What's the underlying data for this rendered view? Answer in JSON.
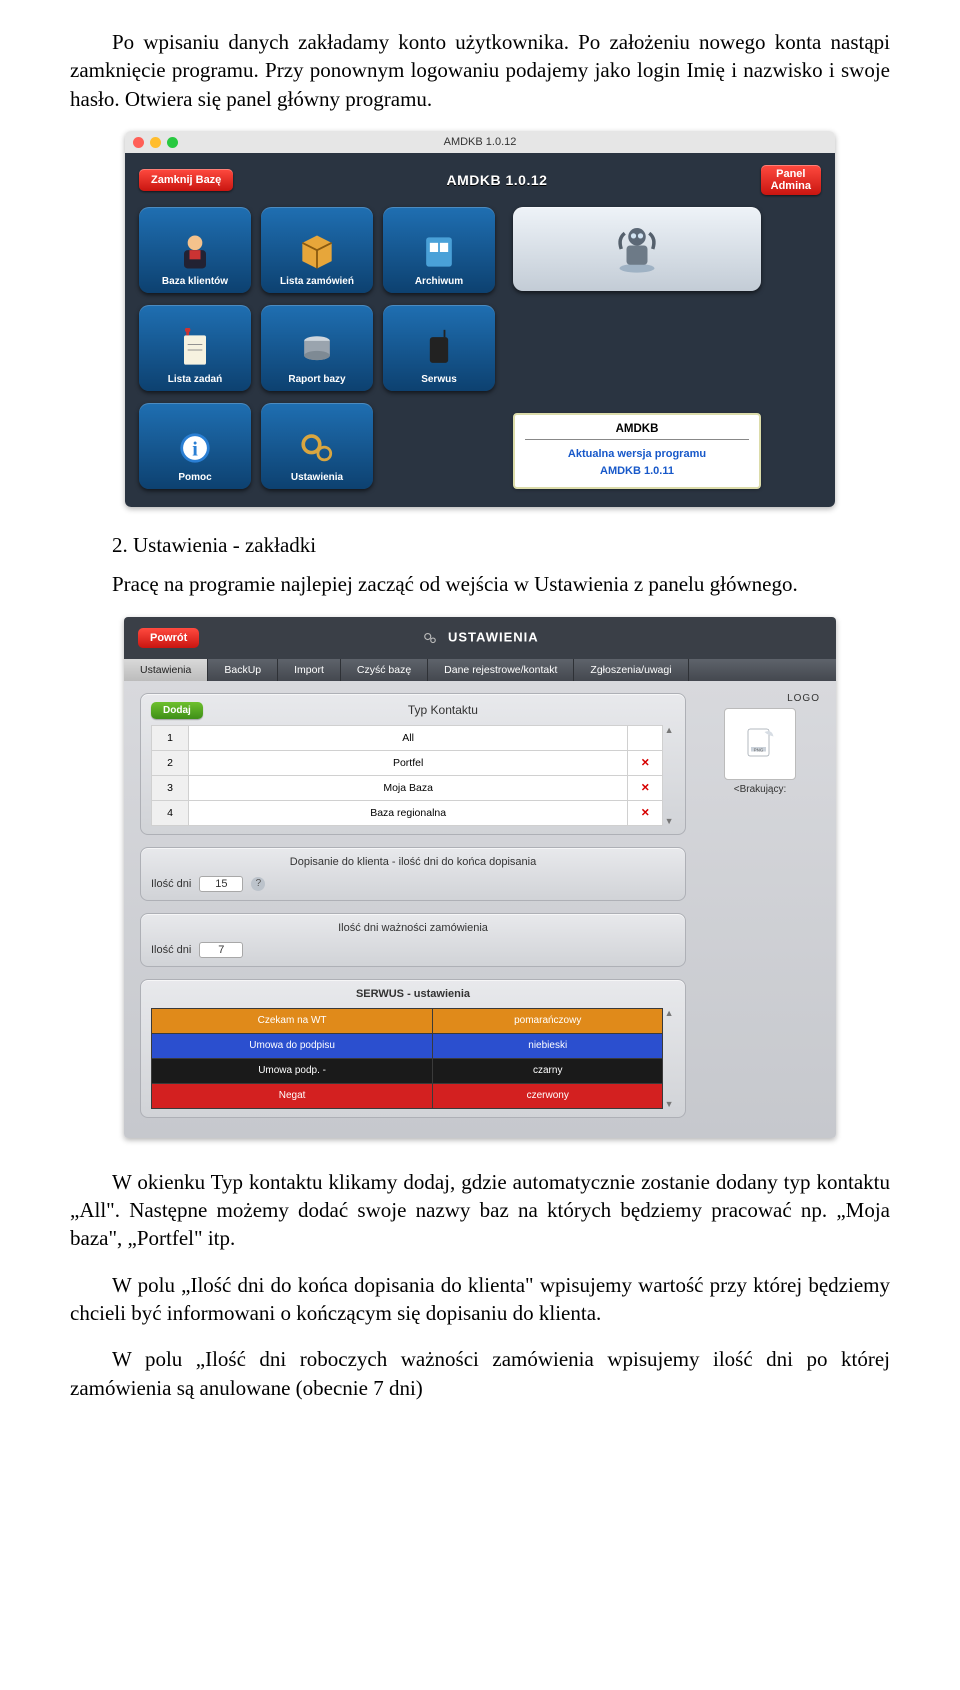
{
  "para1": "Po wpisaniu danych zakładamy konto użytkownika. Po założeniu nowego konta nastąpi zamknięcie programu. Przy ponownym logowaniu podajemy jako login Imię i nazwisko i swoje hasło. Otwiera się panel główny programu.",
  "heading2": "2. Ustawienia - zakładki",
  "para2": "Pracę na programie najlepiej zacząć od wejścia w Ustawienia z panelu głównego.",
  "para3": "W okienku Typ kontaktu klikamy dodaj, gdzie automatycznie zostanie dodany typ kontaktu „All\". Następne możemy dodać swoje nazwy baz na których będziemy pracować np. „Moja baza\", „Portfel\" itp.",
  "para4": "W polu „Ilość dni do końca dopisania do klienta\" wpisujemy wartość przy której będziemy chcieli być informowani o kończącym się dopisaniu do klienta.",
  "para5": "W polu „Ilość dni roboczych ważności zamówienia wpisujemy ilość dni po której zamówienia są anulowane (obecnie 7 dni)",
  "app": {
    "window_title": "AMDKB 1.0.12",
    "close_btn": "Zamknij Bazę",
    "brand": "AMDKB 1.0.12",
    "admin_btn_line1": "Panel",
    "admin_btn_line2": "Admina",
    "tiles": [
      {
        "label": "Baza klientów"
      },
      {
        "label": "Lista zamówień"
      },
      {
        "label": "Archiwum"
      },
      {
        "label": "Lista zadań"
      },
      {
        "label": "Raport bazy"
      },
      {
        "label": "Serwus"
      },
      {
        "label": "Pomoc"
      },
      {
        "label": "Ustawienia"
      }
    ],
    "version_card_heading": "AMDKB",
    "version_line1": "Aktualna wersja programu",
    "version_line2": "AMDKB 1.0.11"
  },
  "settings": {
    "back_btn": "Powrót",
    "title": "USTAWIENIA",
    "tabs": [
      "Ustawienia",
      "BackUp",
      "Import",
      "Czyść bazę",
      "Dane rejestrowe/kontakt",
      "Zgłoszenia/uwagi"
    ],
    "logo_label": "LOGO",
    "logo_caption": "<Brakujący:",
    "panel_typ": {
      "add_btn": "Dodaj",
      "title": "Typ Kontaktu",
      "rows": [
        {
          "n": "1",
          "name": "All",
          "del": ""
        },
        {
          "n": "2",
          "name": "Portfel",
          "del": "✕"
        },
        {
          "n": "3",
          "name": "Moja Baza",
          "del": "✕"
        },
        {
          "n": "4",
          "name": "Baza regionalna",
          "del": "✕"
        }
      ]
    },
    "panel_dopis": {
      "title": "Dopisanie do klienta - ilość dni do końca dopisania",
      "label": "Ilość dni",
      "value": "15"
    },
    "panel_wazn": {
      "title": "Ilość dni ważności zamówienia",
      "label": "Ilość dni",
      "value": "7"
    },
    "panel_serwus": {
      "title": "SERWUS - ustawienia",
      "rows": [
        {
          "left": "Czekam na WT",
          "right": "pomarańczowy",
          "cls": "c-orange"
        },
        {
          "left": "Umowa do podpisu",
          "right": "niebieski",
          "cls": "c-blue"
        },
        {
          "left": "Umowa podp. -",
          "right": "czarny",
          "cls": "c-black"
        },
        {
          "left": "Negat",
          "right": "czerwony",
          "cls": "c-red"
        }
      ]
    }
  }
}
